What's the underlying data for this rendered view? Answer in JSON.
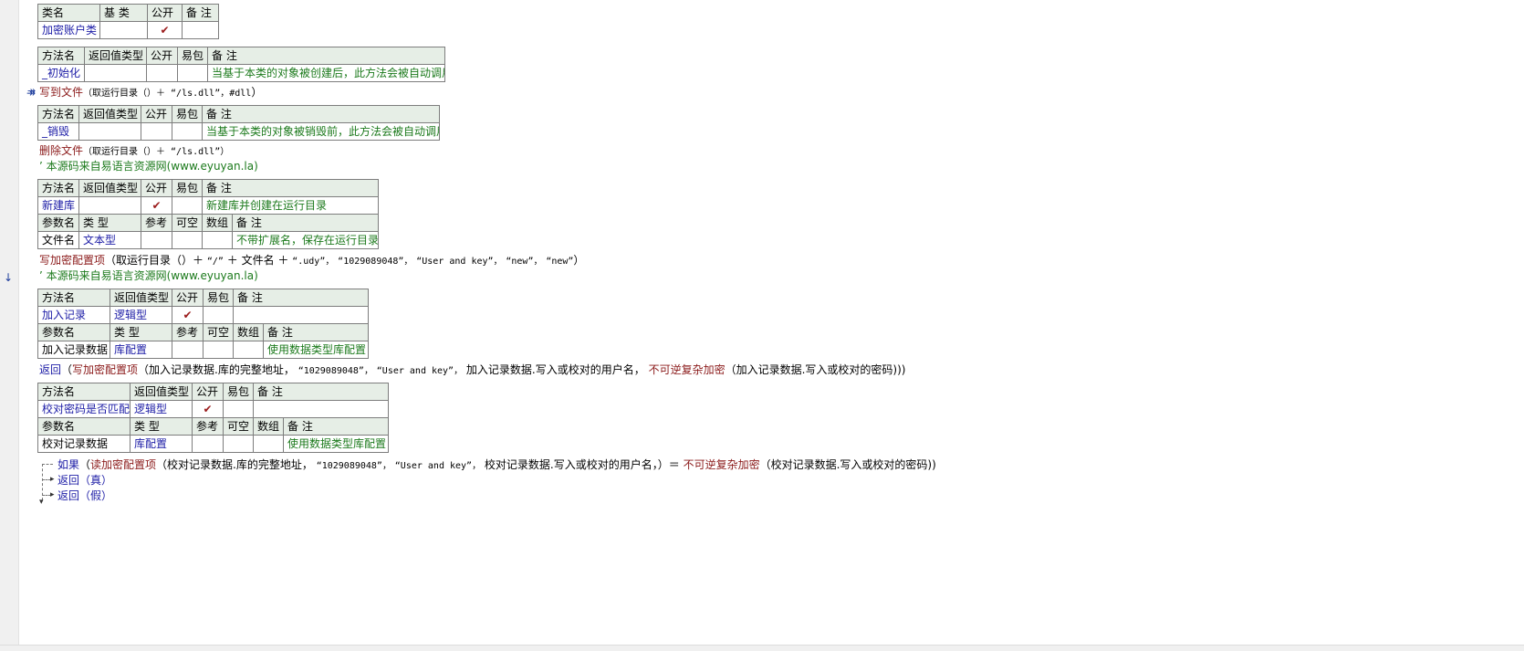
{
  "gutter_marks": [
    "↠",
    "↓"
  ],
  "class_table": {
    "headers": [
      "类名",
      "基 类",
      "公开",
      "备 注"
    ],
    "row": {
      "name": "加密账户类",
      "base": "",
      "public": "✔",
      "note": ""
    }
  },
  "method_init": {
    "headers": [
      "方法名",
      "返回值类型",
      "公开",
      "易包",
      "备 注"
    ],
    "row": {
      "name": "_初始化",
      "ret": "",
      "public": "",
      "pkg": "",
      "note": "当基于本类的对象被创建后，此方法会被自动调用"
    }
  },
  "code_init": {
    "fn": "写到文件",
    "arg1": "（取运行目录（）＋ “/ls.dll”，",
    "arg2": "#dll",
    "close": "）"
  },
  "method_destroy": {
    "headers": [
      "方法名",
      "返回值类型",
      "公开",
      "易包",
      "备 注"
    ],
    "row": {
      "name": "_销毁",
      "ret": "",
      "public": "",
      "pkg": "",
      "note": "当基于本类的对象被销毁前，此方法会被自动调用"
    }
  },
  "code_destroy": {
    "fn": "删除文件",
    "args": "（取运行目录（）＋ “/ls.dll”）"
  },
  "comment1": "’ 本源码来自易语言资源网(www.eyuyan.la)",
  "method_newdb": {
    "headers": [
      "方法名",
      "返回值类型",
      "公开",
      "易包",
      "备 注"
    ],
    "row": {
      "name": "新建库",
      "ret": "",
      "public": "✔",
      "pkg": "",
      "note": "新建库并创建在运行目录"
    },
    "param_headers": [
      "参数名",
      "类 型",
      "参考",
      "可空",
      "数组",
      "备 注"
    ],
    "param": {
      "name": "文件名",
      "type": "文本型",
      "ref": "",
      "opt": "",
      "arr": "",
      "note": "不带扩展名，保存在运行目录"
    }
  },
  "code_newdb": {
    "fn": "写加密配置项",
    "open": "（取运行目录（）＋",
    "s1": "“/”",
    "plus1": "＋ 文件名 ＋",
    "s2": "“.udy”，",
    "s3": "“1029089048”，",
    "s4": "“User and key”，",
    "s5": "“new”，",
    "s6": "“new”",
    "close": "）"
  },
  "comment2": "’ 本源码来自易语言资源网(www.eyuyan.la)",
  "method_addrec": {
    "headers": [
      "方法名",
      "返回值类型",
      "公开",
      "易包",
      "备 注"
    ],
    "row": {
      "name": "加入记录",
      "ret": "逻辑型",
      "public": "✔",
      "pkg": "",
      "note": ""
    },
    "param_headers": [
      "参数名",
      "类 型",
      "参考",
      "可空",
      "数组",
      "备 注"
    ],
    "param": {
      "name": "加入记录数据",
      "type": "库配置",
      "ref": "",
      "opt": "",
      "arr": "",
      "note": "使用数据类型库配置"
    }
  },
  "code_addrec": {
    "kw": "返回",
    "open": "（",
    "fn": "写加密配置项",
    "a1": "（加入记录数据.库的完整地址，",
    "s1": "“1029089048”，",
    "s2": "“User and key”，",
    "a2": "加入记录数据.写入或校对的用户名，",
    "fn2": "不可逆复杂加密",
    "a3": "（加入记录数据.写入或校对的密码)))"
  },
  "method_check": {
    "headers": [
      "方法名",
      "返回值类型",
      "公开",
      "易包",
      "备 注"
    ],
    "row": {
      "name": "校对密码是否匹配",
      "ret": "逻辑型",
      "public": "✔",
      "pkg": "",
      "note": ""
    },
    "param_headers": [
      "参数名",
      "类 型",
      "参考",
      "可空",
      "数组",
      "备 注"
    ],
    "param": {
      "name": "校对记录数据",
      "type": "库配置",
      "ref": "",
      "opt": "",
      "arr": "",
      "note": "使用数据类型库配置"
    }
  },
  "code_check": {
    "kw": "如果",
    "open": "（",
    "fn": "读加密配置项",
    "a1": "（校对记录数据.库的完整地址，",
    "s1": "“1029089048”，",
    "s2": "“User and key”，",
    "a2": "校对记录数据.写入或校对的用户名，）＝",
    "fn2": "不可逆复杂加密",
    "a3": "（校对记录数据.写入或校对的密码))",
    "ret_true": "返回（真）",
    "ret_false": "返回（假）"
  }
}
